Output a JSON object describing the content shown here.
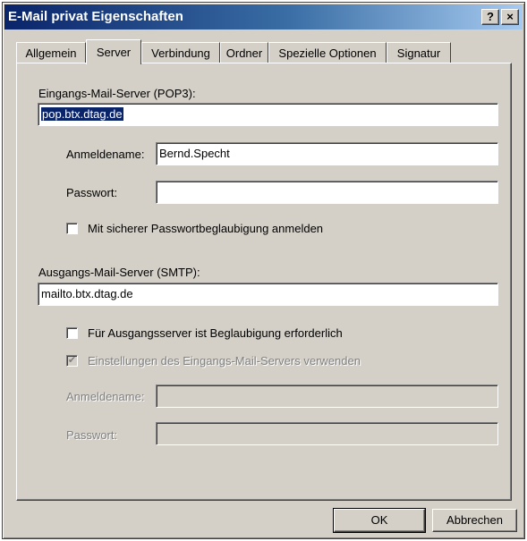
{
  "window": {
    "title": "E-Mail privat Eigenschaften",
    "help_label": "?",
    "close_label": "×"
  },
  "tabs": [
    {
      "label": "Allgemein"
    },
    {
      "label": "Server",
      "active": true
    },
    {
      "label": "Verbindung"
    },
    {
      "label": "Ordner"
    },
    {
      "label": "Spezielle Optionen"
    },
    {
      "label": "Signatur"
    }
  ],
  "incoming": {
    "label": "Eingangs-Mail-Server (POP3):",
    "value": "pop.btx.dtag.de",
    "username_label": "Anmeldename:",
    "username_value": "Bernd.Specht",
    "password_label": "Passwort:",
    "password_value": "",
    "spa_label": "Mit sicherer Passwortbeglaubigung anmelden"
  },
  "outgoing": {
    "label": "Ausgangs-Mail-Server (SMTP):",
    "value": "mailto.btx.dtag.de",
    "auth_label": "Für Ausgangsserver ist Beglaubigung erforderlich",
    "use_incoming_label": "Einstellungen des Eingangs-Mail-Servers verwenden",
    "use_incoming_mark": "✔",
    "username_label": "Anmeldename:",
    "password_label": "Passwort:"
  },
  "buttons": {
    "ok": "OK",
    "cancel": "Abbrechen"
  }
}
